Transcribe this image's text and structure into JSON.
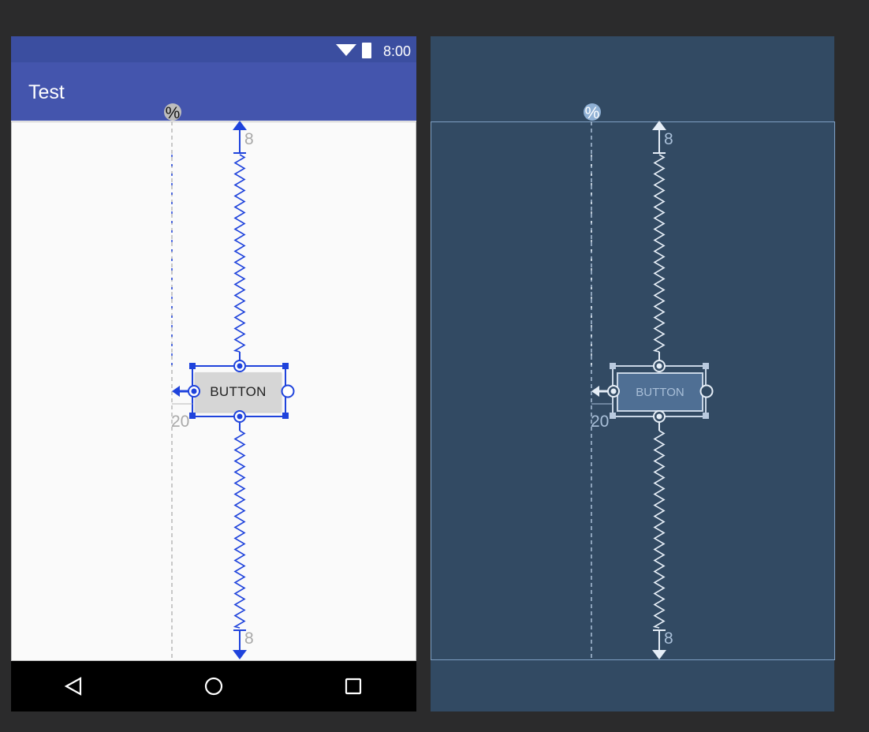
{
  "status_bar": {
    "time": "8:00"
  },
  "app_bar": {
    "title": "Test"
  },
  "widget": {
    "label": "BUTTON"
  },
  "constraints": {
    "top_margin": "8",
    "bottom_margin": "8",
    "guideline_margin": "20",
    "guideline_icon": "%"
  },
  "navigation": {
    "back": "back-icon",
    "home": "home-icon",
    "recents": "recents-icon"
  },
  "colors": {
    "primary_dark": "#3b4ea0",
    "primary": "#4455ad",
    "constraint_blue": "#1f43dc",
    "blueprint_bg": "#324a63",
    "blueprint_line": "#dfe8f3"
  }
}
